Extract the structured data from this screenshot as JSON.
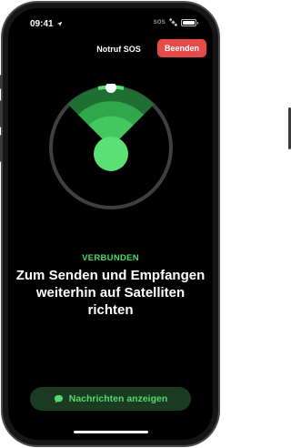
{
  "status_bar": {
    "time": "09:41",
    "sos": "SOS",
    "battery_level": 1.0
  },
  "header": {
    "title": "Notruf SOS",
    "end_button": "Beenden"
  },
  "connection": {
    "status": "VERBUNDEN",
    "instruction": "Zum Senden und Empfangen weiterhin auf Satelliten richten"
  },
  "messages_button": {
    "label": "Nachrichten anzeigen",
    "icon": "speech-bubble-icon"
  },
  "colors": {
    "accent_green": "#4fd86a",
    "end_red": "#e84a4a"
  }
}
